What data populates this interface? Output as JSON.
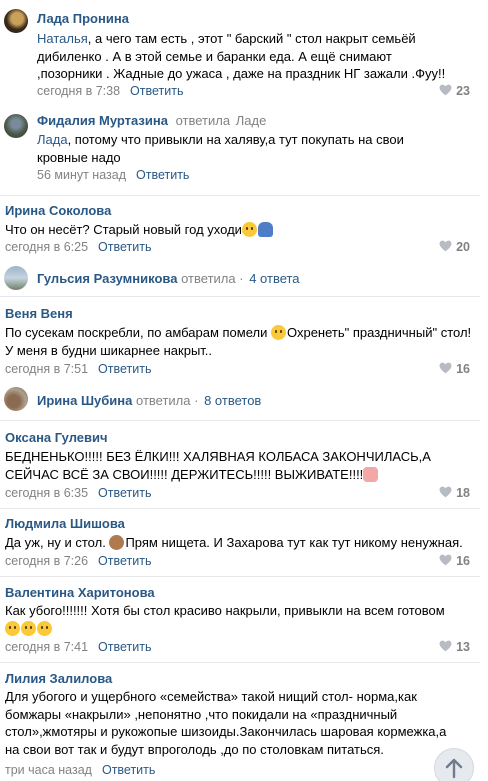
{
  "comments": [
    {
      "author": "Лада Пронина",
      "addressee": "Наталья",
      "text": ", а чего там есть , этот \" барский \" стол накрыт семьёй дибиленко . А в этой семье и баранки еда. А ещё снимают ,позорники . Жадные до ужаса , даже на праздник НГ зажали .Фуу!!",
      "time": "сегодня в 7:38",
      "reply": "Ответить",
      "likes": "23"
    },
    {
      "author": "Фидалия Муртазина",
      "answered_label": "ответила",
      "answered_to": "Ладе",
      "addressee": "Лада",
      "text": ", потому что привыкли на халяву,а тут покупать на свои кровные надо",
      "time": "56 минут назад",
      "reply": "Ответить"
    },
    {
      "author": "Ирина Соколова",
      "text": "Что он несёт? Старый новый год уходи",
      "time": "сегодня в 6:25",
      "reply": "Ответить",
      "likes": "20"
    },
    {
      "author": "Веня Веня",
      "text_a": "По сусекам поскребли, по амбарам помели",
      "text_b": "Охренеть\" праздничный\" стол! У меня в будни шикарнее накрыт..",
      "time": "сегодня в 7:51",
      "reply": "Ответить",
      "likes": "16"
    },
    {
      "author": "Оксана Гулевич",
      "text": "БЕДНЕНЬКО!!!!! БЕЗ ЁЛКИ!!! ХАЛЯВНАЯ КОЛБАСА ЗАКОНЧИЛАСЬ,А СЕЙЧАС ВСЁ ЗА СВОИ!!!!! ДЕРЖИТЕСЬ!!!!! ВЫЖИВАТЕ!!!!",
      "time": "сегодня в 6:35",
      "reply": "Ответить",
      "likes": "18"
    },
    {
      "author": "Людмила Шишова",
      "text_a": "Да уж, ну и стол.",
      "text_b": "Прям нищета. И Захарова тут как тут никому ненужная.",
      "time": "сегодня в 7:26",
      "reply": "Ответить",
      "likes": "16"
    },
    {
      "author": "Валентина Харитонова",
      "text": "Как убого!!!!!!! Хотя бы стол красиво накрыли, привыкли на всем готовом",
      "time": "сегодня в 7:41",
      "reply": "Ответить",
      "likes": "13"
    },
    {
      "author": "Лилия Залилова",
      "text": "Для убогого и ущербного «семейства» такой нищий стол- норма,как бомжары «накрыли» ,непонятно ,что покидали на «праздничный стол»,жмотяры и рукожопые шизоиды.Закончилась шаровая кормежка,а на свои вот так и будут впроголодь ,до по столовкам питаться.",
      "time": "три часа назад",
      "reply": "Ответить"
    }
  ],
  "threads": [
    {
      "author": "Гульсия Разумникова",
      "answered_label": "ответила",
      "count": "4 ответа"
    },
    {
      "author": "Ирина Шубина",
      "answered_label": "ответила",
      "count": "8 ответов"
    }
  ],
  "colors": {
    "link": "#2a5885",
    "meta": "#828282",
    "separator": "#e7e8ec"
  },
  "icons": {
    "like": "heart-icon",
    "scroll": "arrow-up-icon"
  }
}
